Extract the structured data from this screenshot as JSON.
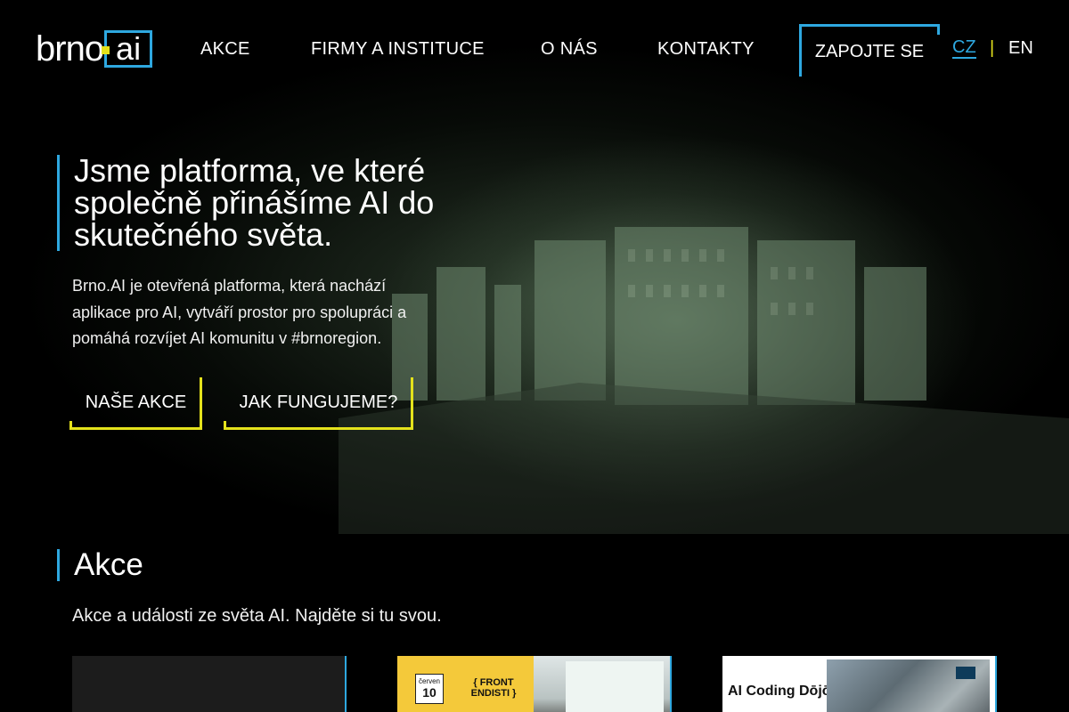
{
  "header": {
    "logo_text": "brno",
    "logo_box_text": "ai",
    "nav": [
      "AKCE",
      "FIRMY A INSTITUCE",
      "O NÁS",
      "KONTAKTY"
    ],
    "cta": "ZAPOJTE SE",
    "lang": {
      "active": "CZ",
      "separator": "|",
      "other": "EN"
    }
  },
  "hero": {
    "title": "Jsme platforma, ve které společně přinášíme AI do skutečného světa.",
    "description": "Brno.AI je otevřená platforma, která nachází aplikace pro AI, vytváří prostor pro spolupráci a pomáhá rozvíjet AI komunitu v #brnoregion.",
    "buttons": [
      "NAŠE AKCE",
      "JAK FUNGUJEME?"
    ]
  },
  "events": {
    "title": "Akce",
    "description": "Akce a události ze světa AI. Najděte si tu svou.",
    "cards": [
      {
        "kind": "empty"
      },
      {
        "month": "červen",
        "day": "10",
        "badge": "{ FRONT ENDISTI }"
      },
      {
        "title": "AI Coding Dōjō"
      }
    ]
  },
  "colors": {
    "accent_blue": "#2ea8e0",
    "accent_yellow": "#e4e21c",
    "background": "#000000"
  }
}
